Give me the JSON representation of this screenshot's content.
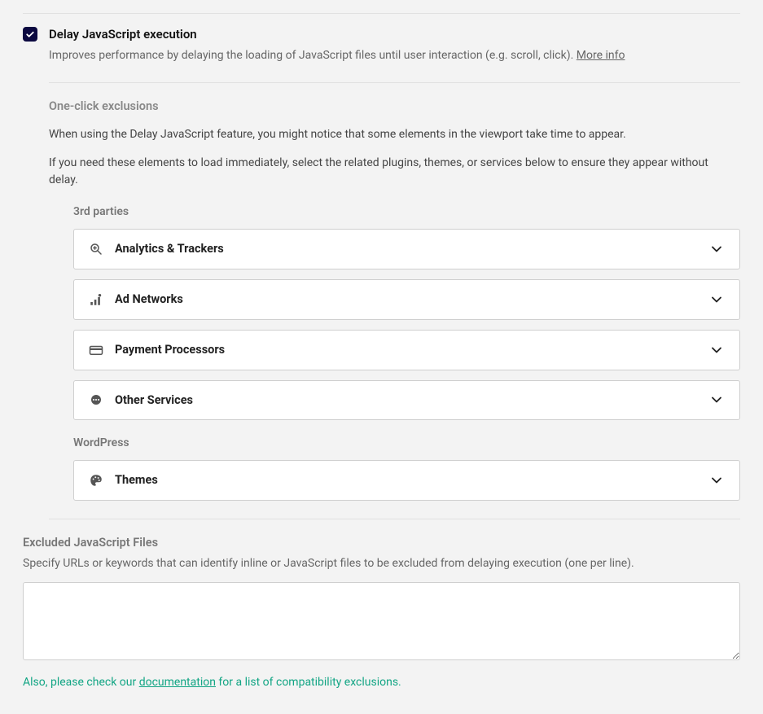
{
  "main": {
    "title": "Delay JavaScript execution",
    "desc": "Improves performance by delaying the loading of JavaScript files until user interaction (e.g. scroll, click). ",
    "moreinfo": "More info",
    "checked": true
  },
  "exclusions": {
    "heading": "One-click exclusions",
    "p1": "When using the Delay JavaScript feature, you might notice that some elements in the viewport take time to appear.",
    "p2": "If you need these elements to load immediately, select the related plugins, themes, or services below to ensure they appear without delay.",
    "groups": {
      "third_parties": {
        "label": "3rd parties",
        "items": [
          {
            "label": "Analytics & Trackers"
          },
          {
            "label": "Ad Networks"
          },
          {
            "label": "Payment Processors"
          },
          {
            "label": "Other Services"
          }
        ]
      },
      "wordpress": {
        "label": "WordPress",
        "items": [
          {
            "label": "Themes"
          }
        ]
      }
    }
  },
  "excluded_files": {
    "title": "Excluded JavaScript Files",
    "desc": "Specify URLs or keywords that can identify inline or JavaScript files to be excluded from delaying execution (one per line).",
    "value": "",
    "note_pre": "Also, please check our ",
    "note_link": "documentation",
    "note_post": " for a list of compatibility exclusions."
  }
}
